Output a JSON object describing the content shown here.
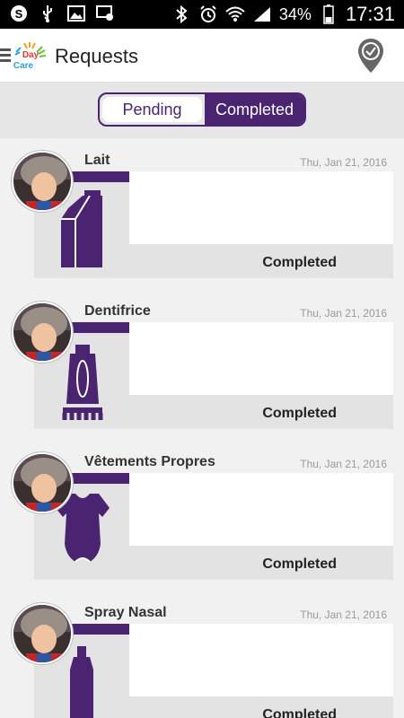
{
  "status_bar": {
    "battery_percent": "34%",
    "time": "17:31"
  },
  "app_bar": {
    "title": "Requests",
    "logo_text_top": "Day",
    "logo_text_bottom": "Care"
  },
  "tabs": {
    "pending_label": "Pending",
    "completed_label": "Completed",
    "active": "Completed"
  },
  "requests": [
    {
      "title": "Lait",
      "date": "Thu, Jan 21, 2016",
      "status": "Completed",
      "icon": "milk-carton-icon"
    },
    {
      "title": "Dentifrice",
      "date": "Thu, Jan 21, 2016",
      "status": "Completed",
      "icon": "toothpaste-icon"
    },
    {
      "title": "Vêtements Propres",
      "date": "Thu, Jan 21, 2016",
      "status": "Completed",
      "icon": "onesie-icon"
    },
    {
      "title": "Spray Nasal",
      "date": "Thu, Jan 21, 2016",
      "status": "Completed",
      "icon": "nasal-spray-icon"
    }
  ],
  "colors": {
    "accent": "#4a2470",
    "card_bg": "#e3e3e3"
  }
}
